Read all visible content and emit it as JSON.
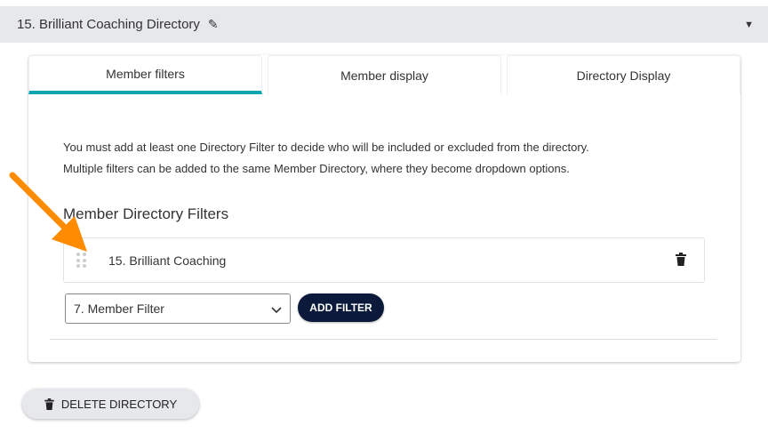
{
  "header": {
    "title": "15.  Brilliant Coaching Directory"
  },
  "tabs": [
    {
      "label": "Member filters",
      "active": true
    },
    {
      "label": "Member display"
    },
    {
      "label": "Directory Display"
    }
  ],
  "description": {
    "line1": "You must add at least one Directory Filter to decide who will be included or excluded from the directory.",
    "line2": "Multiple filters can be added to the same Member Directory, where they become dropdown options."
  },
  "filters": {
    "title": "Member Directory Filters",
    "items": [
      {
        "label": "15. Brilliant Coaching"
      }
    ]
  },
  "select": {
    "value": "7. Member Filter"
  },
  "add_filter_label": "ADD FILTER",
  "delete_directory_label": "DELETE DIRECTORY",
  "colors": {
    "accent": "#0ea5b0",
    "button": "#0b1a3a",
    "arrow": "#ff8c00"
  }
}
